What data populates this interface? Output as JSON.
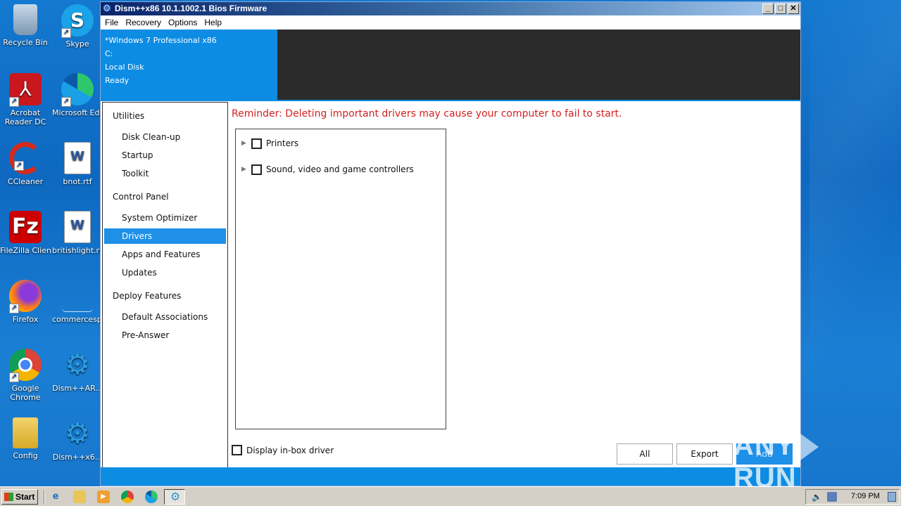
{
  "desktop": {
    "icons": [
      {
        "label": "Recycle Bin",
        "icon": "recycle-bin-icon"
      },
      {
        "label": "Skype",
        "icon": "skype-icon"
      },
      {
        "label": "Acrobat Reader DC",
        "icon": "acrobat-icon"
      },
      {
        "label": "Microsoft Edge",
        "icon": "edge-icon"
      },
      {
        "label": "CCleaner",
        "icon": "ccleaner-icon"
      },
      {
        "label": "bnot.rtf",
        "icon": "word-doc-icon"
      },
      {
        "label": "FileZilla Client",
        "icon": "filezilla-icon"
      },
      {
        "label": "britishlight.rtf",
        "icon": "word-doc-icon"
      },
      {
        "label": "Firefox",
        "icon": "firefox-icon"
      },
      {
        "label": "commercesp...",
        "icon": "blank-file-icon"
      },
      {
        "label": "Google Chrome",
        "icon": "chrome-icon"
      },
      {
        "label": "Dism++AR...",
        "icon": "dism-gear-icon"
      },
      {
        "label": "Config",
        "icon": "folder-icon"
      },
      {
        "label": "Dism++x6...",
        "icon": "dism-gear-icon"
      }
    ]
  },
  "window": {
    "title": "Dism++x86 10.1.1002.1 Bios Firmware",
    "menu": [
      "File",
      "Recovery",
      "Options",
      "Help"
    ],
    "buttons": {
      "minimize": "_",
      "maximize": "□",
      "close": "✕"
    },
    "info": {
      "os": "*Windows 7 Professional x86",
      "drive": "C:",
      "disk": "Local Disk",
      "status": "Ready"
    }
  },
  "sidebar": {
    "sections": [
      {
        "title": "Utilities",
        "items": [
          "Disk Clean-up",
          "Startup",
          "Toolkit"
        ]
      },
      {
        "title": "Control Panel",
        "items": [
          "System Optimizer",
          "Drivers",
          "Apps and Features",
          "Updates"
        ]
      },
      {
        "title": "Deploy Features",
        "items": [
          "Default Associations",
          "Pre-Answer"
        ]
      }
    ],
    "active": "Drivers"
  },
  "content": {
    "reminder": "Reminder: Deleting important drivers may cause your computer to fail to start.",
    "tree": [
      "Printers",
      "Sound, video and game controllers"
    ],
    "inbox_label": "Display in-box driver",
    "buttons": {
      "all": "All",
      "export": "Export",
      "add": "Add"
    }
  },
  "watermark": {
    "left": "ANY",
    "right": "RUN"
  },
  "taskbar": {
    "start": "Start",
    "clock": "7:09 PM"
  },
  "colors": {
    "accent": "#1e90e8",
    "header": "#0d8ce4",
    "reminder": "#d42020"
  }
}
